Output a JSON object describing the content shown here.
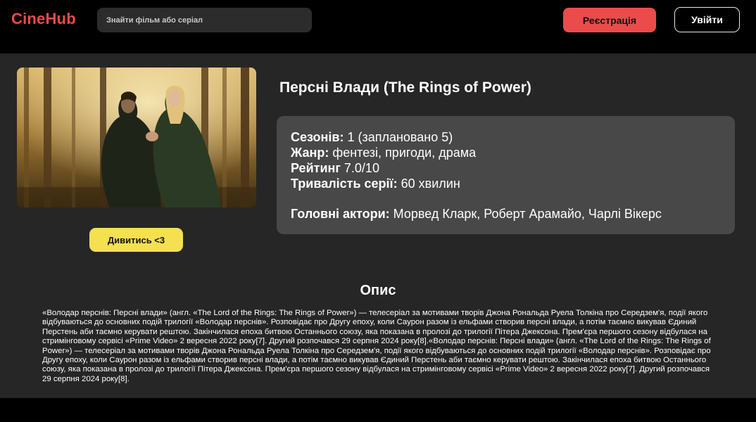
{
  "header": {
    "logo": "CineHub",
    "search_placeholder": "Знайти фільм або серіал",
    "register_label": "Реєстрація",
    "login_label": "Увійти"
  },
  "show": {
    "title": "Персні Влади (The Rings of Power)",
    "watch_label": "Дивитись <3",
    "seasons_label": "Сезонів:",
    "seasons_value": "1 (заплановано 5)",
    "genre_label": "Жанр:",
    "genre_value": "фентезі, пригоди, драма",
    "rating_label": "Рейтинг",
    "rating_value": "7.0/10",
    "duration_label": "Тривалість серії:",
    "duration_value": "60 хвилин",
    "actors_label": "Головні актори:",
    "actors_value": "Морвед Кларк, Роберт Арамайо, Чарлі Вікерс"
  },
  "description": {
    "heading": "Опис",
    "text": "«Володар перснів: Персні влади» (англ. «The Lord of the Rings: The Rings of Power») — телесеріал за мотивами творів Джона Рональда Руела Толкіна про Середзем'я, події якого відбуваються до основних подій трилогії «Володар перснів». Розповідає про Другу епоху, коли Саурон разом із ельфами створив персні влади, а потім таємно викував Єдиний Перстень аби таємно керувати рештою. Закінчилася епоха битвою Останнього союзу, яка показана в пролозі до трилогії Пітера Джексона. Прем'єра першого сезону відбулася на стримінговому сервісі «Prime Video» 2 вересня 2022 року[7]. Другий розпочався 29 серпня 2024 року[8].«Володар перснів: Персні влади» (англ. «The Lord of the Rings: The Rings of Power») — телесеріал за мотивами творів Джона Рональда Руела Толкіна про Середзем'я, події якого відбуваються до основних подій трилогії «Володар перснів». Розповідає про Другу епоху, коли Саурон разом із ельфами створив персні влади, а потім таємно викував Єдиний Перстень аби таємно керувати рештою. Закінчилася епоха битвою Останнього союзу, яка показана в пролозі до трилогії Пітера Джексона. Прем'єра першого сезону відбулася на стримінговому сервісі «Prime Video» 2 вересня 2022 року[7]. Другий розпочався 29 серпня 2024 року[8]."
  },
  "colors": {
    "accent": "#ec4b4b",
    "watch_button": "#f5e04f",
    "panel": "#484848",
    "background": "#262626"
  }
}
